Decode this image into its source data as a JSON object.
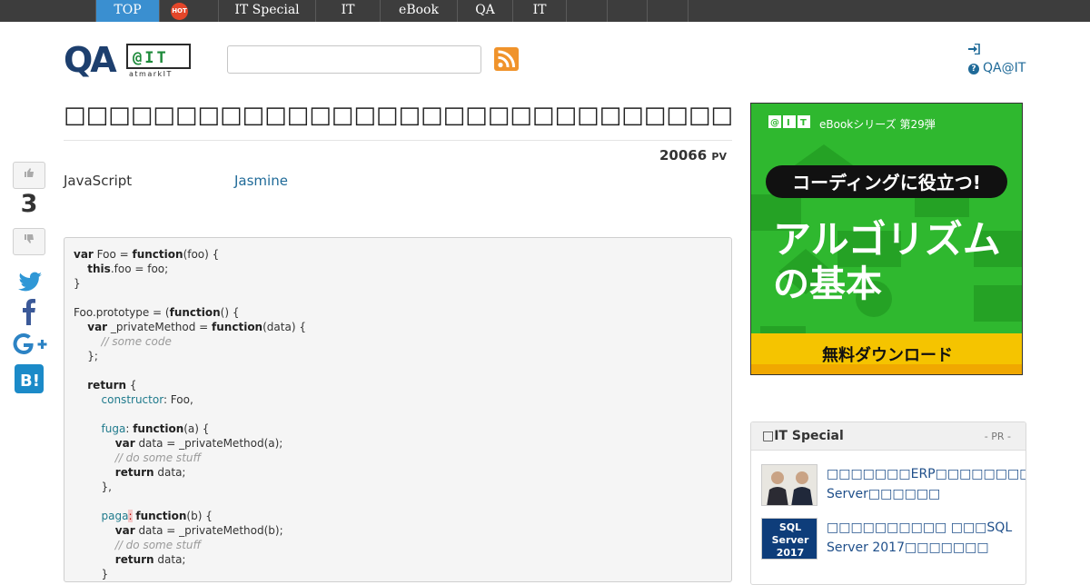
{
  "nav": {
    "items": [
      {
        "label": "TOP"
      },
      {
        "label": ""
      },
      {
        "label": "IT Special"
      },
      {
        "label": "IT"
      },
      {
        "label": "eBook"
      },
      {
        "label": "QA"
      },
      {
        "label": "IT"
      },
      {
        "label": ""
      },
      {
        "label": ""
      },
      {
        "label": ""
      }
    ],
    "hot_badge": "HOT"
  },
  "header": {
    "logo_main": "QA",
    "logo_at": "@IT",
    "logo_sub": "atmarkIT",
    "search": {
      "value": "",
      "placeholder": ""
    },
    "help_label": "QA@IT"
  },
  "vote": {
    "count": "3"
  },
  "question": {
    "title": "□□□□□□□□□□□□□□□□□□□□□□□□□□□□□□□□",
    "pv_value": "20066",
    "pv_unit": "PV",
    "tags": [
      "JavaScript",
      "Jasmine"
    ]
  },
  "code_lines": [
    "var Foo = function(foo) {",
    "    this.foo = foo;",
    "}",
    "",
    "Foo.prototype = (function() {",
    "    var _privateMethod = function(data) {",
    "        // some code",
    "    };",
    "",
    "    return {",
    "        constructor: Foo,",
    "",
    "        fuga: function(a) {",
    "            var data = _privateMethod(a);",
    "            // do some stuff",
    "            return data;",
    "        },",
    "",
    "        paga: function(b) {",
    "            var data = _privateMethod(b);",
    "            // do some stuff",
    "            return data;",
    "        }"
  ],
  "ad": {
    "series": "eBookシリーズ 第29弾",
    "tagline": "コーディングに役立つ!",
    "title_line1": "アルゴリズム",
    "title_line2": "の基本",
    "cta": "無料ダウンロード"
  },
  "special": {
    "title": "□IT Special",
    "pr": "- PR -",
    "items": [
      {
        "text": "□□□□□□□ERP□□□□□□□□SQL Server□□□□□□"
      },
      {
        "text": "□□□□□□□□□□ □□□SQL Server 2017□□□□□□□"
      }
    ],
    "thumb2_text": "SQL Server 2017"
  },
  "colors": {
    "nav_bg": "#3d3d3d",
    "nav_active": "#3a8fd0",
    "link": "#1f6a98",
    "ad_green": "#2fb82f",
    "ad_yellow": "#f5c400"
  }
}
